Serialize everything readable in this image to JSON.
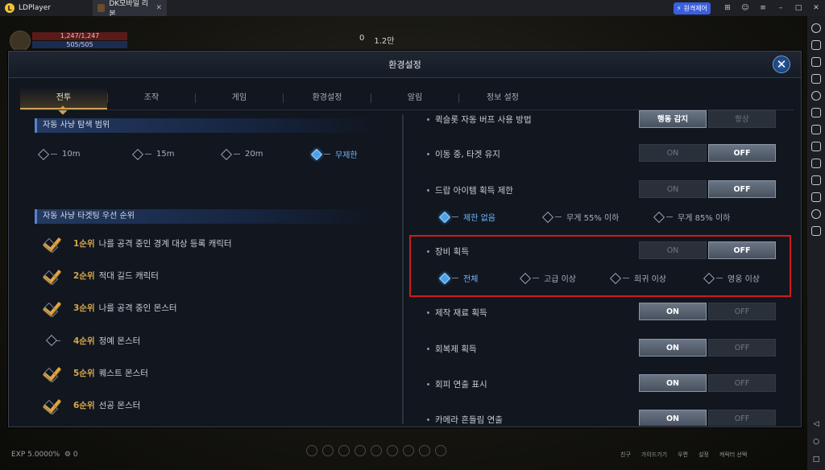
{
  "emulator": {
    "app_name": "LDPlayer",
    "logo_letter": "L",
    "tab_title": "DK모바일 리본",
    "badge_label": "원격제어",
    "controls": [
      "⊞",
      "☺",
      "≡",
      "–",
      "□",
      "✕"
    ]
  },
  "hud": {
    "hp_text": "1,247/1,247",
    "mp_text": "505/505",
    "currency_a": "0",
    "currency_b": "1.2만",
    "exp_text": "EXP 5.0000%",
    "gear_count": "0",
    "bottom_menu": [
      "친구",
      "가이드가기",
      "우편",
      "설정",
      "캐릭터 선택"
    ]
  },
  "dialog": {
    "title": "환경설정",
    "close_symbol": "✕",
    "tabs": [
      "전투",
      "조작",
      "게임",
      "환경설정",
      "알림",
      "정보 설정"
    ],
    "active_tab": "전투"
  },
  "left": {
    "hunt_range": {
      "title": "자동 사냥 탐색 범위",
      "options": [
        "10m",
        "15m",
        "20m",
        "무제한"
      ],
      "selected": "무제한"
    },
    "targeting": {
      "title": "자동 사냥 타겟팅 우선 순위",
      "items": [
        {
          "rank": "1순위",
          "label": "나를 공격 중인 경계 대상 등록 캐릭터",
          "checked": true
        },
        {
          "rank": "2순위",
          "label": "적대 길드 캐릭터",
          "checked": true
        },
        {
          "rank": "3순위",
          "label": "나를 공격 중인 몬스터",
          "checked": true
        },
        {
          "rank": "4순위",
          "label": "정예 몬스터",
          "checked": false
        },
        {
          "rank": "5순위",
          "label": "퀘스트 몬스터",
          "checked": true
        },
        {
          "rank": "6순위",
          "label": "선공 몬스터",
          "checked": true
        }
      ]
    }
  },
  "right": {
    "quickslot": {
      "label": "퀵슬롯 자동 버프 사용 방법",
      "opt_a": "행동 감지",
      "opt_b": "항상",
      "selected": "행동 감지"
    },
    "keep_target": {
      "label": "이동 중, 타겟 유지",
      "on": "ON",
      "off": "OFF",
      "value": "OFF"
    },
    "drop_limit": {
      "label": "드랍 아이템 획득 제한",
      "on": "ON",
      "off": "OFF",
      "value": "OFF",
      "options": [
        "제한 없음",
        "무게 55% 이하",
        "무게 85% 이하"
      ],
      "selected": "제한 없음"
    },
    "equip_pickup": {
      "label": "장비 획득",
      "on": "ON",
      "off": "OFF",
      "value": "OFF",
      "options": [
        "전체",
        "고급 이상",
        "희귀 이상",
        "영웅 이상"
      ],
      "selected": "전체"
    },
    "material_pickup": {
      "label": "제작 재료 획득",
      "on": "ON",
      "off": "OFF",
      "value": "ON"
    },
    "potion_pickup": {
      "label": "회복제 획득",
      "on": "ON",
      "off": "OFF",
      "value": "ON"
    },
    "dodge_effect": {
      "label": "회피 연출 표시",
      "on": "ON",
      "off": "OFF",
      "value": "ON"
    },
    "camera_shake": {
      "label": "카메라 흔들림 연출",
      "on": "ON",
      "off": "OFF",
      "value": "ON"
    }
  },
  "colors": {
    "highlight_box": "#d11a1a",
    "accent_gold": "#c9a255",
    "radio_selected": "#4ea1e6"
  }
}
